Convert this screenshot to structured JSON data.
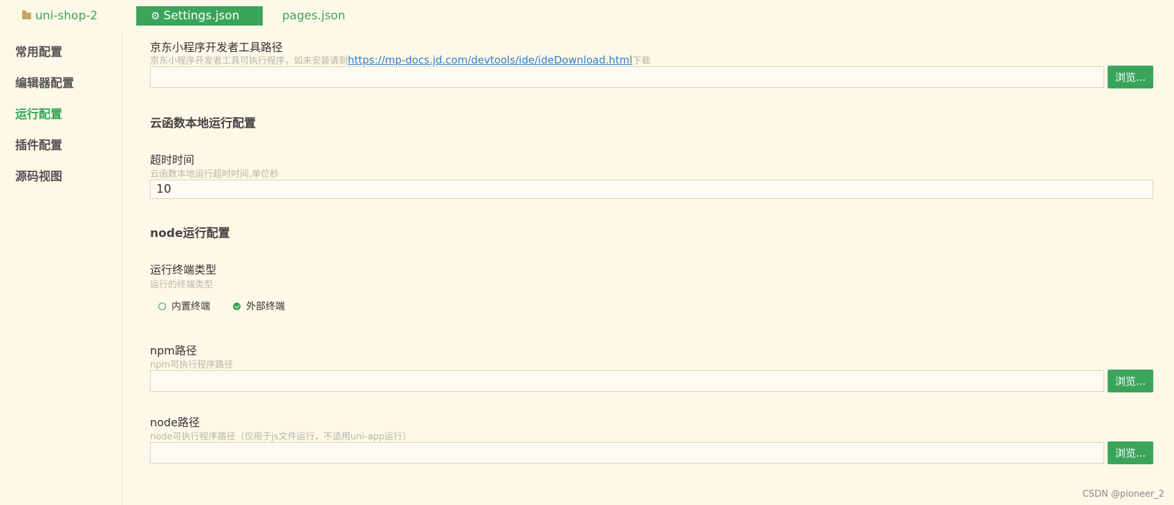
{
  "tabs": {
    "project": "uni-shop-2",
    "settings": "Settings.json",
    "pages": "pages.json"
  },
  "sidebar": {
    "items": [
      {
        "label": "常用配置"
      },
      {
        "label": "编辑器配置"
      },
      {
        "label": "运行配置",
        "active": true
      },
      {
        "label": "插件配置"
      },
      {
        "label": "源码视图"
      }
    ]
  },
  "jd": {
    "title": "京东小程序开发者工具路径",
    "desc_prefix": "京东小程序开发者工具可执行程序，如未安装请到",
    "link": "https://mp-docs.jd.com/devtools/ide/ideDownload.html",
    "desc_suffix": "下载",
    "value": "",
    "browse": "浏览..."
  },
  "cloud_section": "云函数本地运行配置",
  "timeout": {
    "title": "超时时间",
    "desc": "云函数本地运行超时时间,单位秒",
    "value": "10"
  },
  "node_section": "node运行配置",
  "terminal": {
    "title": "运行终端类型",
    "desc": "运行的终端类型",
    "options": [
      {
        "label": "内置终端",
        "checked": false
      },
      {
        "label": "外部终端",
        "checked": true
      }
    ]
  },
  "npm": {
    "title": "npm路径",
    "desc": "npm可执行程序路径",
    "value": "",
    "browse": "浏览..."
  },
  "node": {
    "title": "node路径",
    "desc": "node可执行程序路径（仅用于js文件运行，不适用uni-app运行）",
    "value": "",
    "browse": "浏览..."
  },
  "watermark": "CSDN @pioneer_2",
  "colors": {
    "accent": "#3aa55a",
    "background": "#fdf8e7",
    "link": "#2a7fd4"
  }
}
